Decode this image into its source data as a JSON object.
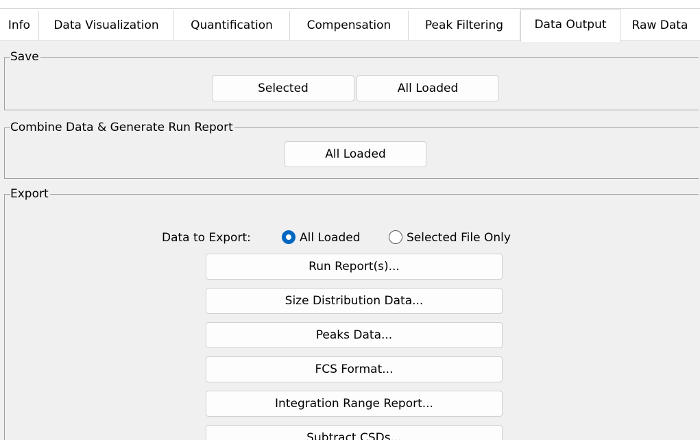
{
  "tabs": [
    {
      "label": "Info"
    },
    {
      "label": "Data Visualization"
    },
    {
      "label": "Quantification"
    },
    {
      "label": "Compensation"
    },
    {
      "label": "Peak Filtering"
    },
    {
      "label": "Data Output",
      "active": true
    },
    {
      "label": "Raw Data"
    }
  ],
  "save": {
    "title": "Save",
    "selected_label": "Selected",
    "all_loaded_label": "All Loaded"
  },
  "combine": {
    "title": "Combine Data & Generate Run Report",
    "all_loaded_label": "All Loaded"
  },
  "export": {
    "title": "Export",
    "data_to_export_label": "Data to Export:",
    "options": [
      {
        "label": "All Loaded",
        "checked": true
      },
      {
        "label": "Selected File Only",
        "checked": false
      }
    ],
    "buttons": [
      {
        "label": "Run Report(s)..."
      },
      {
        "label": "Size Distribution Data..."
      },
      {
        "label": "Peaks Data..."
      },
      {
        "label": "FCS Format..."
      },
      {
        "label": "Integration Range Report..."
      },
      {
        "label": "Subtract CSDs..."
      }
    ]
  },
  "colors": {
    "radio_accent": "#0067c0",
    "window_bg": "#f0f0f0",
    "tab_bg": "#ffffff"
  }
}
